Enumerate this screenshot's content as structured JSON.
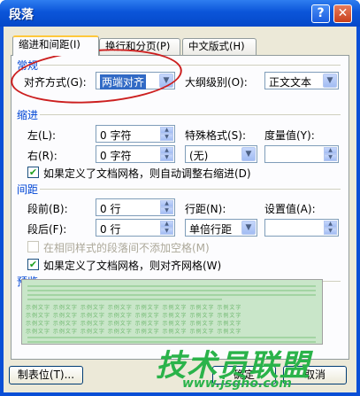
{
  "window": {
    "title": "段落"
  },
  "titlebar": {
    "help_label": "?",
    "close_label": "✕"
  },
  "tabs": [
    {
      "label": "缩进和间距(I)",
      "active": true
    },
    {
      "label": "换行和分页(P)",
      "active": false
    },
    {
      "label": "中文版式(H)",
      "active": false
    }
  ],
  "general": {
    "heading": "常规",
    "alignment_label": "对齐方式(G):",
    "alignment_value": "两端对齐",
    "outline_label": "大纲级别(O):",
    "outline_value": "正文文本"
  },
  "indent": {
    "heading": "缩进",
    "left_label": "左(L):",
    "left_value": "0 字符",
    "right_label": "右(R):",
    "right_value": "0 字符",
    "special_label": "特殊格式(S):",
    "special_value": "(无)",
    "measure_label": "度量值(Y):",
    "measure_value": "",
    "auto_adjust_label": "如果定义了文档网格，则自动调整右缩进(D)",
    "auto_adjust_checked": true
  },
  "spacing": {
    "heading": "间距",
    "before_label": "段前(B):",
    "before_value": "0 行",
    "after_label": "段后(F):",
    "after_value": "0 行",
    "line_spacing_label": "行距(N):",
    "line_spacing_value": "单倍行距",
    "setting_label": "设置值(A):",
    "setting_value": "",
    "no_space_same_style_label": "在相同样式的段落间不添加空格(M)",
    "no_space_same_style_checked": false,
    "snap_grid_label": "如果定义了文档网格，则对齐网格(W)",
    "snap_grid_checked": true
  },
  "preview": {
    "heading": "预览",
    "sample_text": "示例文字 示例文字 示例文字 示例文字 示例文字 示例文字 示例文字 示例文字"
  },
  "footer": {
    "tabs_button": "制表位(T)...",
    "ok_button": "确定",
    "cancel_button": "取消"
  },
  "watermark": {
    "title": "技术员联盟",
    "url": "www.jsgho.com"
  },
  "colors": {
    "title_bar": "#0b55d9",
    "dialog_bg": "#ece9d8",
    "section_heading": "#0046d5",
    "annotation": "#cc1f1f",
    "watermark": "#2ab34a"
  }
}
